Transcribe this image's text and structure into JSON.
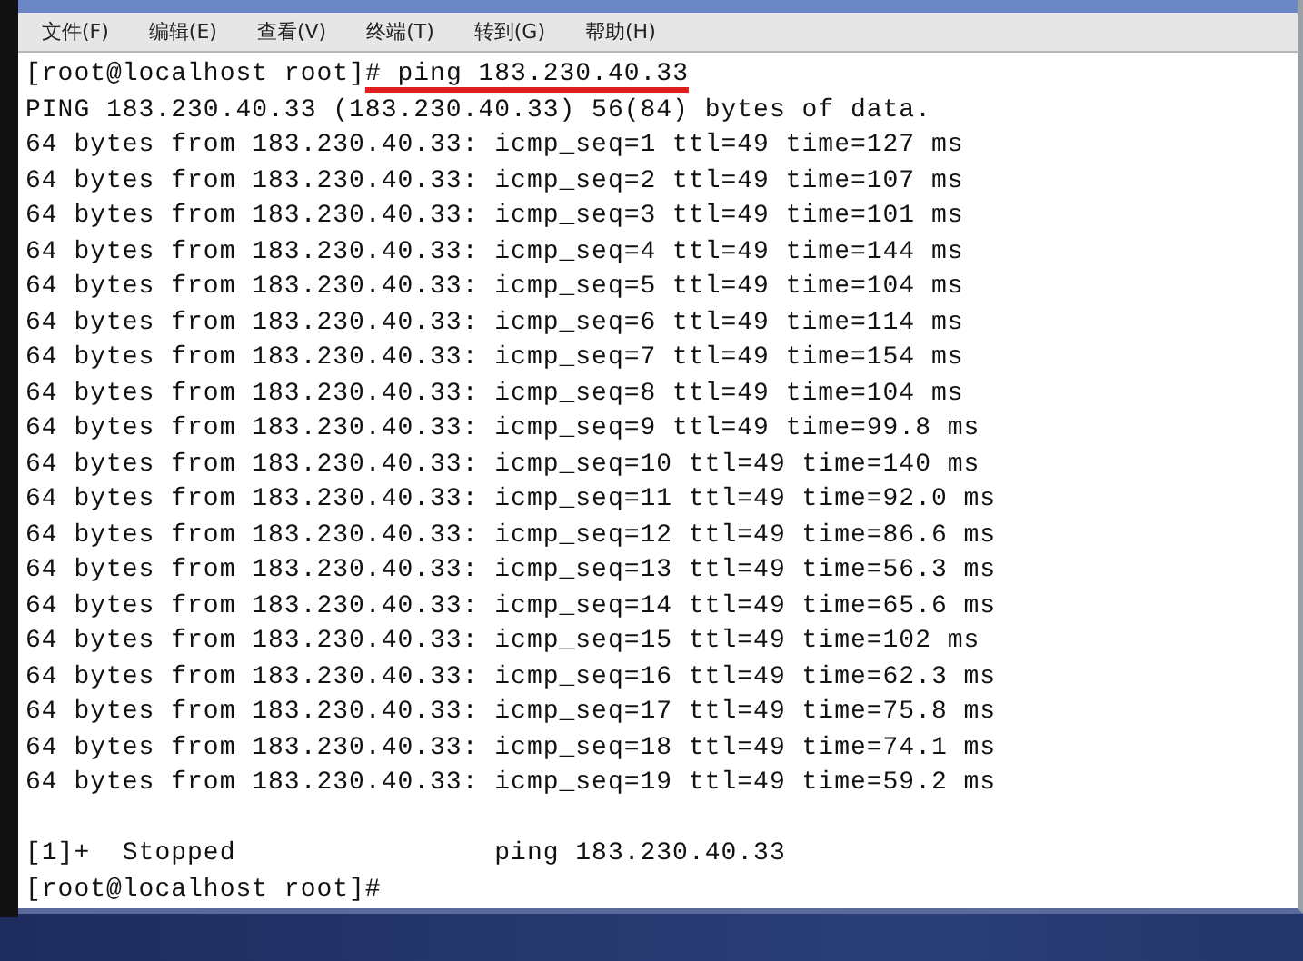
{
  "menu_bar": [
    {
      "label": "文件(F)"
    },
    {
      "label": "编辑(E)"
    },
    {
      "label": "查看(V)"
    },
    {
      "label": "终端(T)"
    },
    {
      "label": "转到(G)"
    },
    {
      "label": "帮助(H)"
    }
  ],
  "terminal": {
    "command_line": {
      "prompt": "[root@localhost root]",
      "command": "# ping 183.230.40.33",
      "underlined": true
    },
    "lines": [
      "PING 183.230.40.33 (183.230.40.33) 56(84) bytes of data.",
      "64 bytes from 183.230.40.33: icmp_seq=1 ttl=49 time=127 ms",
      "64 bytes from 183.230.40.33: icmp_seq=2 ttl=49 time=107 ms",
      "64 bytes from 183.230.40.33: icmp_seq=3 ttl=49 time=101 ms",
      "64 bytes from 183.230.40.33: icmp_seq=4 ttl=49 time=144 ms",
      "64 bytes from 183.230.40.33: icmp_seq=5 ttl=49 time=104 ms",
      "64 bytes from 183.230.40.33: icmp_seq=6 ttl=49 time=114 ms",
      "64 bytes from 183.230.40.33: icmp_seq=7 ttl=49 time=154 ms",
      "64 bytes from 183.230.40.33: icmp_seq=8 ttl=49 time=104 ms",
      "64 bytes from 183.230.40.33: icmp_seq=9 ttl=49 time=99.8 ms",
      "64 bytes from 183.230.40.33: icmp_seq=10 ttl=49 time=140 ms",
      "64 bytes from 183.230.40.33: icmp_seq=11 ttl=49 time=92.0 ms",
      "64 bytes from 183.230.40.33: icmp_seq=12 ttl=49 time=86.6 ms",
      "64 bytes from 183.230.40.33: icmp_seq=13 ttl=49 time=56.3 ms",
      "64 bytes from 183.230.40.33: icmp_seq=14 ttl=49 time=65.6 ms",
      "64 bytes from 183.230.40.33: icmp_seq=15 ttl=49 time=102 ms",
      "64 bytes from 183.230.40.33: icmp_seq=16 ttl=49 time=62.3 ms",
      "64 bytes from 183.230.40.33: icmp_seq=17 ttl=49 time=75.8 ms",
      "64 bytes from 183.230.40.33: icmp_seq=18 ttl=49 time=74.1 ms",
      "64 bytes from 183.230.40.33: icmp_seq=19 ttl=49 time=59.2 ms"
    ],
    "lines_after_blank": [
      "[1]+  Stopped                ping 183.230.40.33",
      "[root@localhost root]#"
    ]
  }
}
